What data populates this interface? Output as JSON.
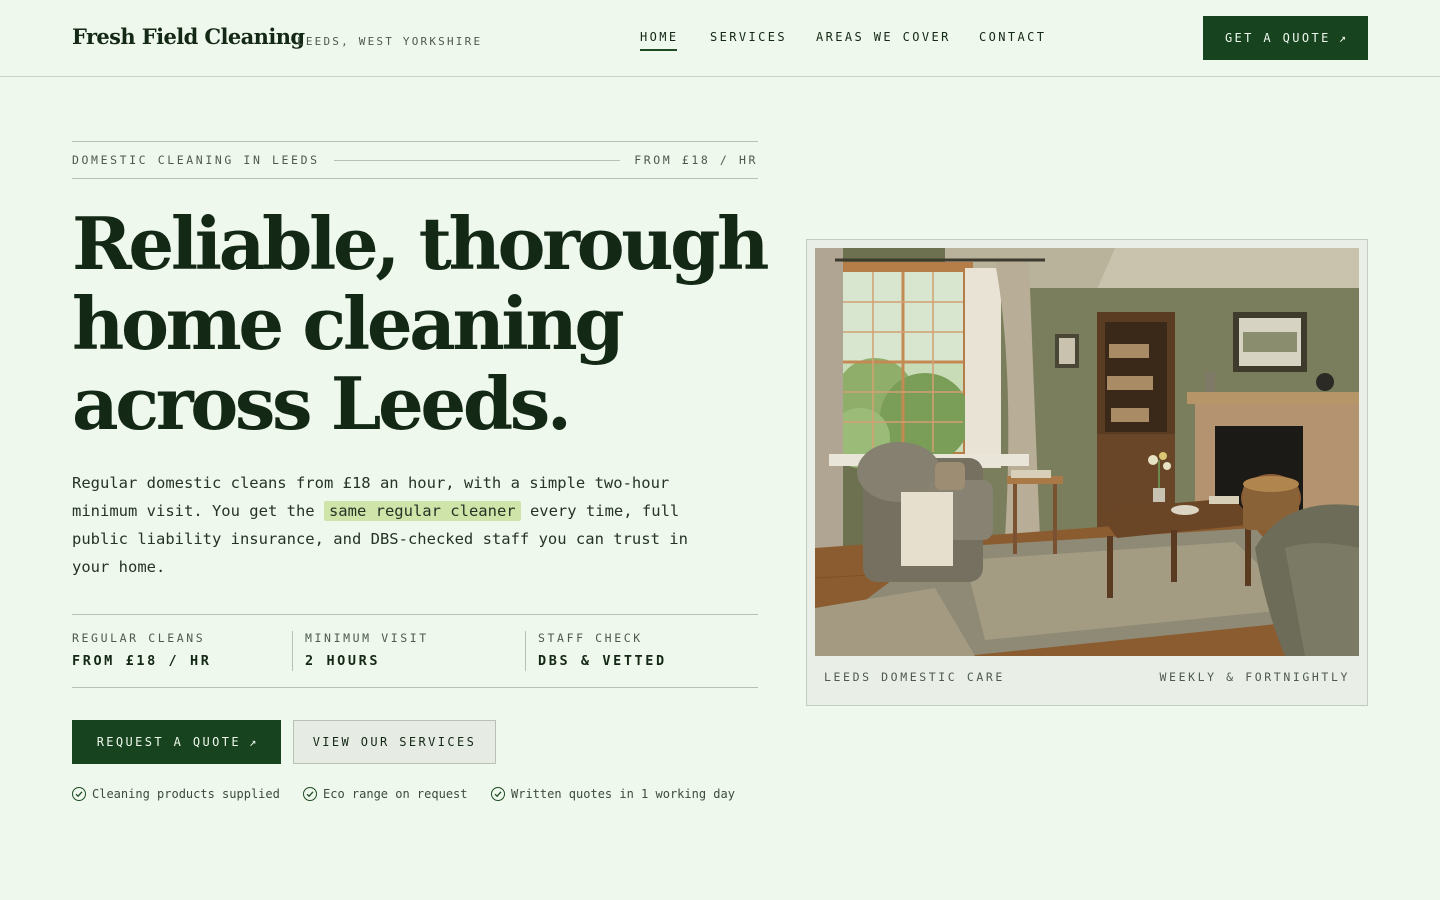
{
  "header": {
    "brand": "Fresh Field Cleaning",
    "location": "LEEDS, WEST YORKSHIRE",
    "nav": [
      "HOME",
      "SERVICES",
      "AREAS WE COVER",
      "CONTACT"
    ],
    "active_nav": "HOME",
    "cta": "GET A QUOTE",
    "cta_icon": "arrow-up-right-icon"
  },
  "hero": {
    "eyebrow_left": "DOMESTIC CLEANING IN LEEDS",
    "eyebrow_right": "FROM £18 / HR",
    "headline": [
      "Reliable, thorough",
      "home cleaning",
      "across Leeds."
    ],
    "lede_before": "Regular domestic cleans from £18 an hour, with a simple two-hour minimum visit. You get the ",
    "lede_highlight": "same regular cleaner",
    "lede_after": " every time, full public liability insurance, and DBS-checked staff you can trust in your home.",
    "stats": [
      {
        "label": "REGULAR CLEANS",
        "value": "FROM £18 / HR"
      },
      {
        "label": "MINIMUM VISIT",
        "value": "2 HOURS"
      },
      {
        "label": "STAFF CHECK",
        "value": "DBS & VETTED"
      }
    ],
    "primary_cta": "REQUEST A QUOTE",
    "secondary_cta": "VIEW OUR SERVICES",
    "perks": [
      "Cleaning products supplied",
      "Eco range on request",
      "Written quotes in 1 working day"
    ]
  },
  "photo_card": {
    "caption_left": "LEEDS DOMESTIC CARE",
    "caption_right": "WEEKLY & FORTNIGHTLY"
  },
  "colors": {
    "background": "#eef8ec",
    "brand_green": "#17431f",
    "highlight": "#cfe4a8",
    "text": "#142816"
  }
}
